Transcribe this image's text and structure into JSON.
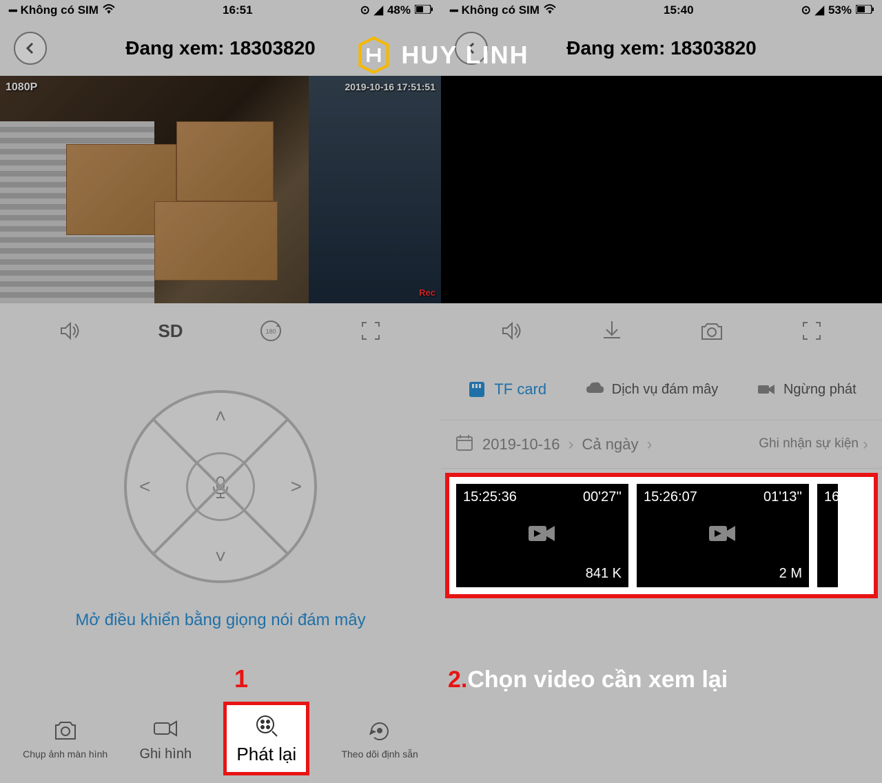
{
  "logo_text": "HUY LINH",
  "left": {
    "status": {
      "carrier": "Không có SIM",
      "time": "16:51",
      "battery": "48%"
    },
    "header": {
      "title": "Đang xem: 18303820"
    },
    "video": {
      "resolution": "1080P",
      "timestamp": "2019-10-16 17:51:51",
      "rec": "Rec"
    },
    "controls": {
      "quality": "SD"
    },
    "voice_link": "Mở điều khiển bằng giọng nói đám mây",
    "nav": {
      "screenshot": "Chụp ảnh màn hình",
      "record": "Ghi hình",
      "playback": "Phát lại",
      "preset": "Theo dõi định sẵn"
    },
    "annotation": "1"
  },
  "right": {
    "status": {
      "carrier": "Không có SIM",
      "time": "15:40",
      "battery": "53%"
    },
    "header": {
      "title": "Đang xem: 18303820"
    },
    "sources": {
      "tf": "TF card",
      "cloud": "Dịch vụ đám mây",
      "stop": "Ngừng phát"
    },
    "filter": {
      "date": "2019-10-16",
      "range": "Cả ngày",
      "events": "Ghi nhận sự kiện"
    },
    "clips": [
      {
        "time": "15:25:36",
        "duration": "00'27''",
        "size": "841 K"
      },
      {
        "time": "15:26:07",
        "duration": "01'13''",
        "size": "2 M"
      },
      {
        "time": "16",
        "duration": "",
        "size": ""
      }
    ],
    "annotation_num": "2.",
    "annotation_text": "Chọn video cần xem lại"
  }
}
